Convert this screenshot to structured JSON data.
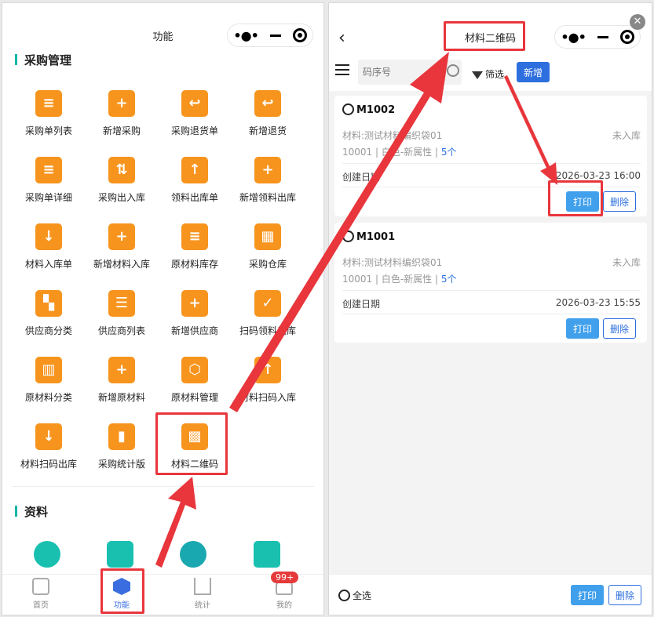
{
  "left": {
    "title": "功能",
    "section_purchase": "采购管理",
    "items": [
      {
        "label": "采购单列表",
        "icon": "clipboard-list-icon",
        "glyph": "≡"
      },
      {
        "label": "新增采购",
        "icon": "cart-add-icon",
        "glyph": "+"
      },
      {
        "label": "采购退货单",
        "icon": "return-clipboard-icon",
        "glyph": "↩"
      },
      {
        "label": "新增退货",
        "icon": "return-box-icon",
        "glyph": "↩"
      },
      {
        "label": "采购单详细",
        "icon": "list-detail-icon",
        "glyph": "≡"
      },
      {
        "label": "采购出入库",
        "icon": "in-out-icon",
        "glyph": "⇅"
      },
      {
        "label": "领料出库单",
        "icon": "upload-tray-icon",
        "glyph": "↑"
      },
      {
        "label": "新增领料出库",
        "icon": "add-doc-icon",
        "glyph": "+"
      },
      {
        "label": "材料入库单",
        "icon": "download-tray-icon",
        "glyph": "↓"
      },
      {
        "label": "新增材料入库",
        "icon": "add-list-icon",
        "glyph": "+"
      },
      {
        "label": "原材料库存",
        "icon": "stock-doc-icon",
        "glyph": "≡"
      },
      {
        "label": "采购仓库",
        "icon": "warehouse-icon",
        "glyph": "▦"
      },
      {
        "label": "供应商分类",
        "icon": "category-grid-icon",
        "glyph": "▚"
      },
      {
        "label": "供应商列表",
        "icon": "supplier-list-icon",
        "glyph": "☰"
      },
      {
        "label": "新增供应商",
        "icon": "add-supplier-icon",
        "glyph": "+"
      },
      {
        "label": "扫码领料出库",
        "icon": "scan-out-icon",
        "glyph": "✓"
      },
      {
        "label": "原材料分类",
        "icon": "material-category-icon",
        "glyph": "▥"
      },
      {
        "label": "新增原材料",
        "icon": "add-material-icon",
        "glyph": "+"
      },
      {
        "label": "原材料管理",
        "icon": "hexagon-box-icon",
        "glyph": "⬡"
      },
      {
        "label": "材料扫码入库",
        "icon": "scan-in-icon",
        "glyph": "↑"
      },
      {
        "label": "材料扫码出库",
        "icon": "scan-export-icon",
        "glyph": "↓"
      },
      {
        "label": "采购统计版",
        "icon": "bar-chart-icon",
        "glyph": "▮"
      },
      {
        "label": "材料二维码",
        "icon": "qr-code-icon",
        "glyph": "▩"
      }
    ],
    "section_data": "资料",
    "tabs": [
      {
        "label": "首页",
        "icon": "home-icon"
      },
      {
        "label": "功能",
        "icon": "cube-icon"
      },
      {
        "label": "统计",
        "icon": "stats-icon"
      },
      {
        "label": "我的",
        "icon": "user-icon"
      }
    ],
    "badge": "99+"
  },
  "right": {
    "title": "材料二维码",
    "search_placeholder": "码序号",
    "filter_label": "筛选",
    "new_label": "新增",
    "cards": [
      {
        "code": "M1002",
        "material": "材料:测试材料编织袋01",
        "status": "未入库",
        "meta_prefix": "10001 | 白色-新属性 | ",
        "count": "5个",
        "date_label": "创建日期",
        "date": "2026-03-23 16:00"
      },
      {
        "code": "M1001",
        "material": "材料:测试材料编织袋01",
        "status": "未入库",
        "meta_prefix": "10001 | 白色-新属性 | ",
        "count": "5个",
        "date_label": "创建日期",
        "date": "2026-03-23 15:55"
      }
    ],
    "print_label": "打印",
    "delete_label": "删除",
    "select_all": "全选"
  },
  "colors": {
    "accent_orange": "#f7941d",
    "teal": "#19c0b0",
    "blue": "#2d6fde",
    "highlight_red": "#e8363c"
  }
}
